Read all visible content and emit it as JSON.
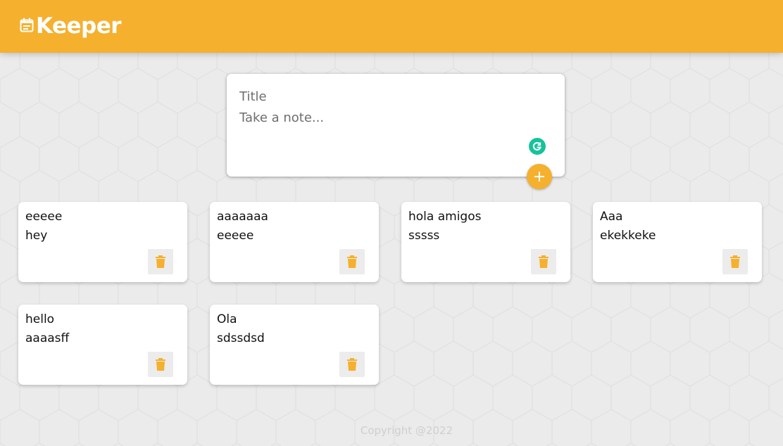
{
  "header": {
    "brand": "Keeper",
    "brand_color": "#f5b02e",
    "icon": "note-icon"
  },
  "composer": {
    "title_placeholder": "Title",
    "title_value": "",
    "note_placeholder": "Take a note...",
    "note_value": "",
    "add_icon": "plus-icon",
    "grammar_icon": "grammarly-icon"
  },
  "notes": [
    {
      "title": "eeeee",
      "content": "hey"
    },
    {
      "title": "aaaaaaa",
      "content": "eeeee"
    },
    {
      "title": "hola amigos",
      "content": "sssss"
    },
    {
      "title": "Aaa",
      "content": "ekekkeke"
    },
    {
      "title": "hello",
      "content": "aaaasff"
    },
    {
      "title": "Ola",
      "content": "sdssdsd"
    }
  ],
  "note_delete_icon": "trash-icon",
  "footer": {
    "copyright": "Copyright @2022"
  }
}
